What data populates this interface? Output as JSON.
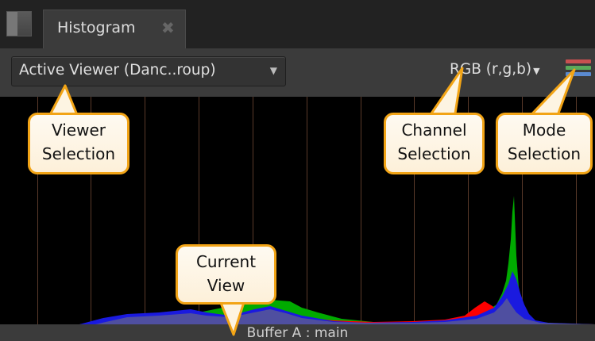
{
  "tab": {
    "label": "Histogram",
    "close_glyph": "✖"
  },
  "toolbar": {
    "viewer_select": "Active Viewer (Danc..roup)",
    "channel_select": "RGB (r,g,b)",
    "mode_icon": "histogram-mode-icon",
    "mode_colors": [
      "#c85050",
      "#5aaa5a",
      "#5a8ad0"
    ]
  },
  "status": {
    "buffer": "Buffer A : main"
  },
  "callouts": {
    "viewer": [
      "Viewer",
      "Selection"
    ],
    "channel": [
      "Channel",
      "Selection"
    ],
    "mode": [
      "Mode",
      "Selection"
    ],
    "view": [
      "Current",
      "View"
    ]
  },
  "colors": {
    "callout_border": "#f2a416",
    "grid_line": "#5a3a2a",
    "red": "#ff0000",
    "green": "#00aa00",
    "blue": "#1a1adf",
    "overlap": "#555599"
  }
}
